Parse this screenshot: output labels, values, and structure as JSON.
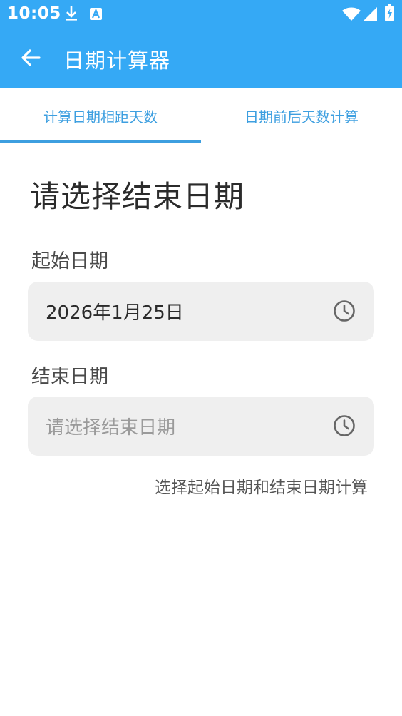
{
  "status_bar": {
    "time": "10:05",
    "icons": [
      "download-icon",
      "a-notification-icon",
      "wifi-icon",
      "signal-icon",
      "battery-charging-icon"
    ]
  },
  "toolbar": {
    "title": "日期计算器",
    "back_icon": "arrow-back-icon"
  },
  "tabs": [
    {
      "label": "计算日期相距天数",
      "selected": true
    },
    {
      "label": "日期前后天数计算",
      "selected": false
    }
  ],
  "main": {
    "headline": "请选择结束日期",
    "start_label": "起始日期",
    "start_value": "2026年1月25日",
    "end_label": "结束日期",
    "end_placeholder": "请选择结束日期",
    "field_icon": "clock-icon",
    "hint": "选择起始日期和结束日期计算"
  },
  "colors": {
    "primary": "#35A9F5",
    "tab_accent": "#3D9FE0",
    "field_bg": "#EFEFEF"
  }
}
